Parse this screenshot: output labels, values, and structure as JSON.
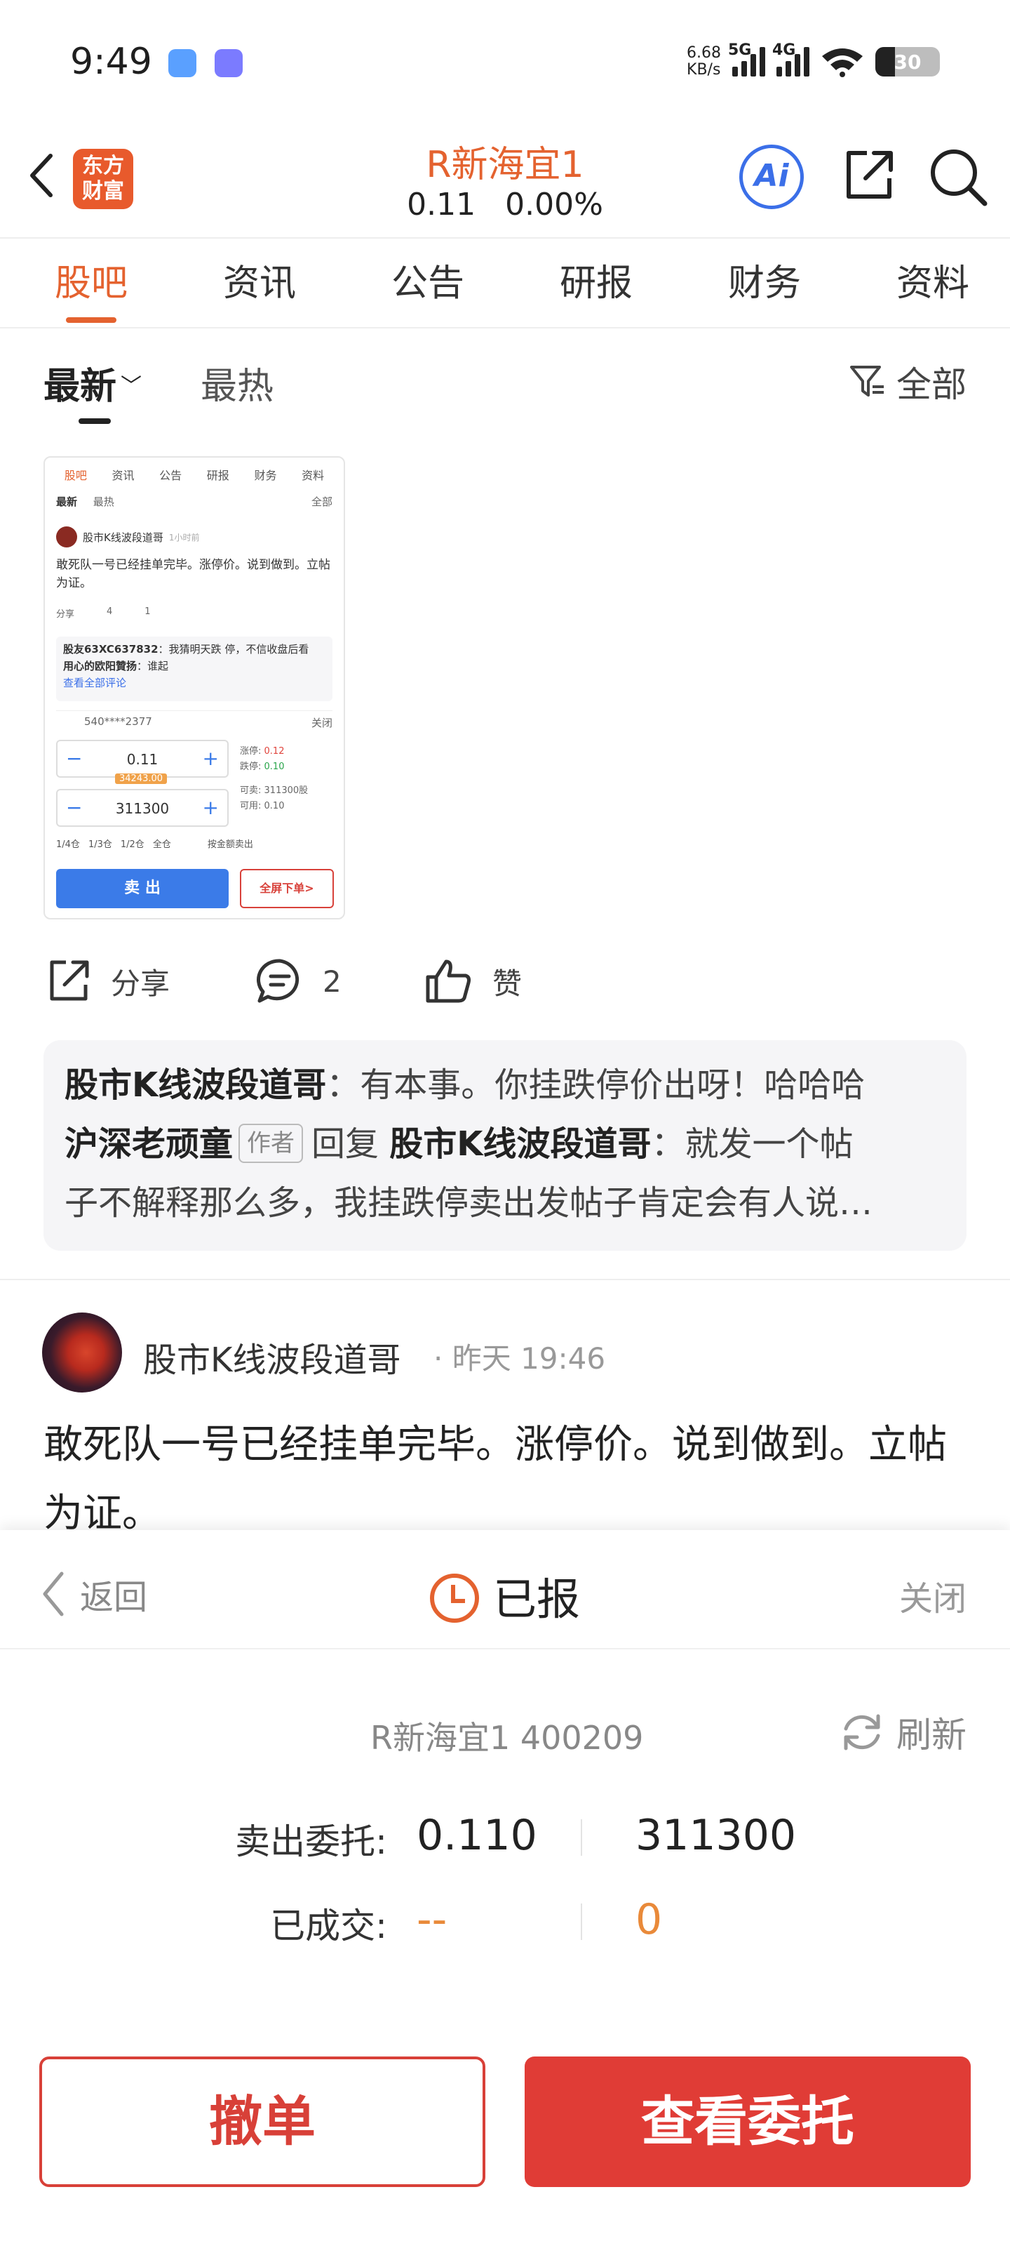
{
  "status_bar": {
    "time": "9:49",
    "net_speed_value": "6.68",
    "net_speed_unit": "KB/s",
    "net_5g": "5G",
    "net_4g": "4G",
    "wifi_level": "6",
    "battery": "30",
    "battery_level": 0.3
  },
  "header": {
    "logo_text_line1": "东方",
    "logo_text_line2": "财富",
    "stock_name": "R新海宜1",
    "price": "0.11",
    "change_pct": "0.00%",
    "ai_label": "Ai"
  },
  "tabs": [
    "股吧",
    "资讯",
    "公告",
    "研报",
    "财务",
    "资料"
  ],
  "active_tab": 0,
  "sort": {
    "latest": "最新",
    "hot": "最热",
    "filter": "全部"
  },
  "thumbnail": {
    "tabs": [
      "股吧",
      "资讯",
      "公告",
      "研报",
      "财务",
      "资料"
    ],
    "sort_latest": "最新",
    "sort_hot": "最热",
    "filter": "全部",
    "author": "股市K线波段道哥",
    "time": "1小时前",
    "body": "敢死队一号已经挂单完毕。涨停价。说到做到。立帖为证。",
    "share": "分享",
    "comments": "4",
    "likes": "1",
    "comment1_user": "股友63XC637832",
    "comment1_text": "：我猜明天跌 停，不信收盘后看",
    "comment2_user": "用心的欧阳贊扬",
    "comment2_text": "：谁起",
    "view_all": "查看全部评论",
    "account": "540****2377",
    "close": "关闭",
    "price_value": "0.11",
    "qty_value": "311300",
    "qty_tip": "34243.00",
    "limit_up_label": "涨停:",
    "limit_up": "0.12",
    "limit_down_label": "跌停:",
    "limit_down": "0.10",
    "sellable_label": "可卖:",
    "sellable": "311300股",
    "available_label": "可用:",
    "available": "0.10",
    "positions": [
      "1/4仓",
      "1/3仓",
      "1/2仓",
      "全仓"
    ],
    "by_amount": "按金额卖出",
    "sell": "卖 出",
    "full_order": "全屏下单>"
  },
  "post_actions": {
    "share": "分享",
    "comments": "2",
    "like": "赞"
  },
  "comments": [
    {
      "user": "股市K线波段道哥",
      "text": "：有本事。你挂跌停价出呀！哈哈哈"
    },
    {
      "user": "沪深老顽童",
      "tag": "作者",
      "reply_word": "回复",
      "reply_to": "股市K线波段道哥",
      "text": "：就发一个帖子不解释那么多，我挂跌停卖出发帖子肯定会有人说…"
    }
  ],
  "comment2_tail": "子不解释那么多，我挂跌停卖出发帖子肯定会有人说…",
  "comment2_head": "：就发一个帖",
  "post": {
    "author": "股市K线波段道哥",
    "dot": "·",
    "time": "昨天 19:46",
    "body": "敢死队一号已经挂单完毕。涨停价。说到做到。立帖为证。"
  },
  "sheet": {
    "back": "返回",
    "status": "已报",
    "close": "关闭",
    "stock": "R新海宜1 400209",
    "refresh": "刷新",
    "entrust_label": "卖出委托:",
    "entrust_price": "0.110",
    "entrust_qty": "311300",
    "deal_label": "已成交:",
    "deal_price": "--",
    "deal_qty": "0",
    "cancel_btn": "撤单",
    "view_btn": "查看委托"
  },
  "colors": {
    "brand_orange": "#e4622f",
    "primary_red": "#e03c36",
    "ai_blue": "#3b6fe8",
    "deal_orange": "#e98a3a"
  }
}
